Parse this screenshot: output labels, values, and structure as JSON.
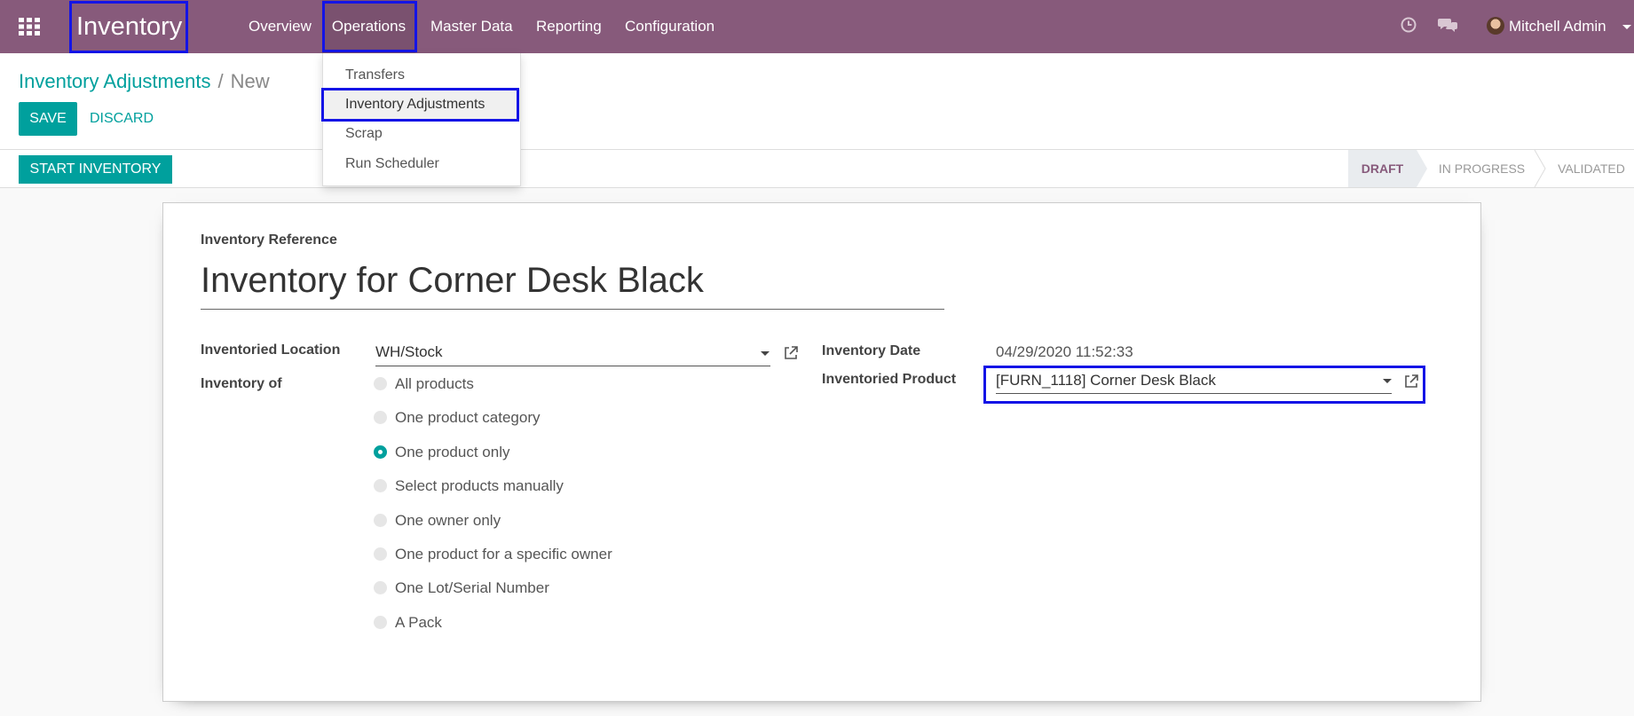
{
  "navbar": {
    "app_name": "Inventory",
    "menus": [
      "Overview",
      "Operations",
      "Master Data",
      "Reporting",
      "Configuration"
    ],
    "user_name": "Mitchell Admin",
    "icons": [
      "apps-grid-icon",
      "clock-icon",
      "chat-icon"
    ]
  },
  "operations_menu": {
    "items": [
      "Transfers",
      "Inventory Adjustments",
      "Scrap",
      "Run Scheduler"
    ]
  },
  "breadcrumb": {
    "parent": "Inventory Adjustments",
    "separator": "/",
    "current": "New"
  },
  "buttons": {
    "save": "SAVE",
    "discard": "DISCARD",
    "start_inventory": "START INVENTORY"
  },
  "statusbar": {
    "stages": [
      "DRAFT",
      "IN PROGRESS",
      "VALIDATED"
    ],
    "current": "DRAFT"
  },
  "form": {
    "reference_label": "Inventory Reference",
    "reference_value": "Inventory for Corner Desk Black",
    "location_label": "Inventoried Location",
    "location_value": "WH/Stock",
    "inventory_of_label": "Inventory of",
    "inventory_of_options": [
      "All products",
      "One product category",
      "One product only",
      "Select products manually",
      "One owner only",
      "One product for a specific owner",
      "One Lot/Serial Number",
      "A Pack"
    ],
    "inventory_of_selected": "One product only",
    "date_label": "Inventory Date",
    "date_value": "04/29/2020 11:52:33",
    "product_label": "Inventoried Product",
    "product_value": "[FURN_1118] Corner Desk Black"
  },
  "colors": {
    "navbar": "#875a7b",
    "primary": "#00a09d",
    "highlight_box": "#1414e6"
  }
}
